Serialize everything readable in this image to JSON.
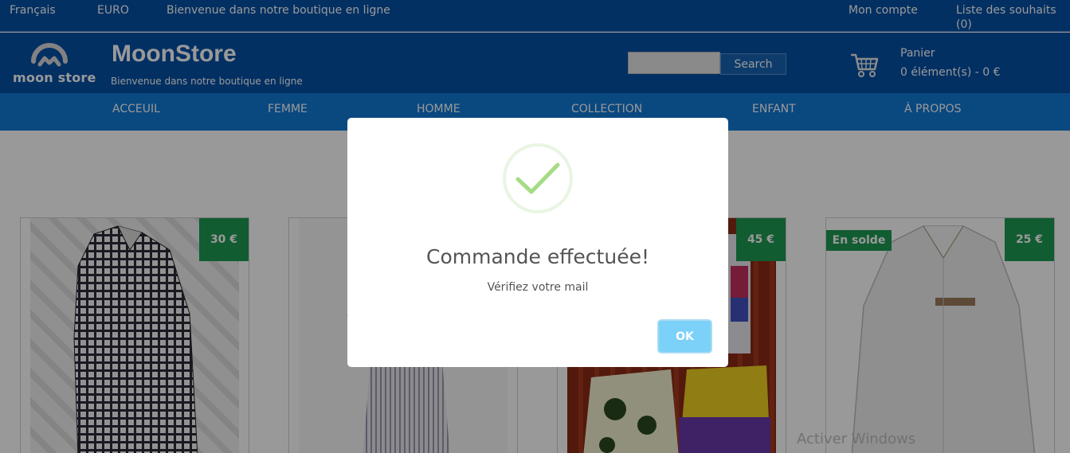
{
  "topbar": {
    "language": "Français",
    "currency": "EURO",
    "welcome": "Bienvenue dans notre boutique en ligne",
    "account": "Mon compte",
    "wishlist": "Liste des souhaits (0)"
  },
  "header": {
    "logo_text": "moon store",
    "brand": "MoonStore",
    "tagline": "Bienvenue dans notre boutique en ligne",
    "search_button": "Search",
    "search_placeholder": "",
    "cart_label": "Panier",
    "cart_count": "0 élément(s) - 0 €"
  },
  "nav": [
    "ACCEUIL",
    "FEMME",
    "HOMME",
    "COLLECTION",
    "ENFANT",
    "À PROPOS"
  ],
  "products": [
    {
      "price": "30 €",
      "sale": ""
    },
    {
      "price": "",
      "sale": ""
    },
    {
      "price": "45 €",
      "sale": ""
    },
    {
      "price": "25 €",
      "sale": "En solde"
    }
  ],
  "modal": {
    "title": "Commande effectuée!",
    "text": "Vérifiez votre mail",
    "ok": "OK"
  },
  "watermark": "Activer Windows",
  "colors": {
    "primary": "#0450a6",
    "nav": "#1179d6",
    "badge": "#1d9a53",
    "ok": "#7cd1f9",
    "check": "#a5dc86"
  }
}
